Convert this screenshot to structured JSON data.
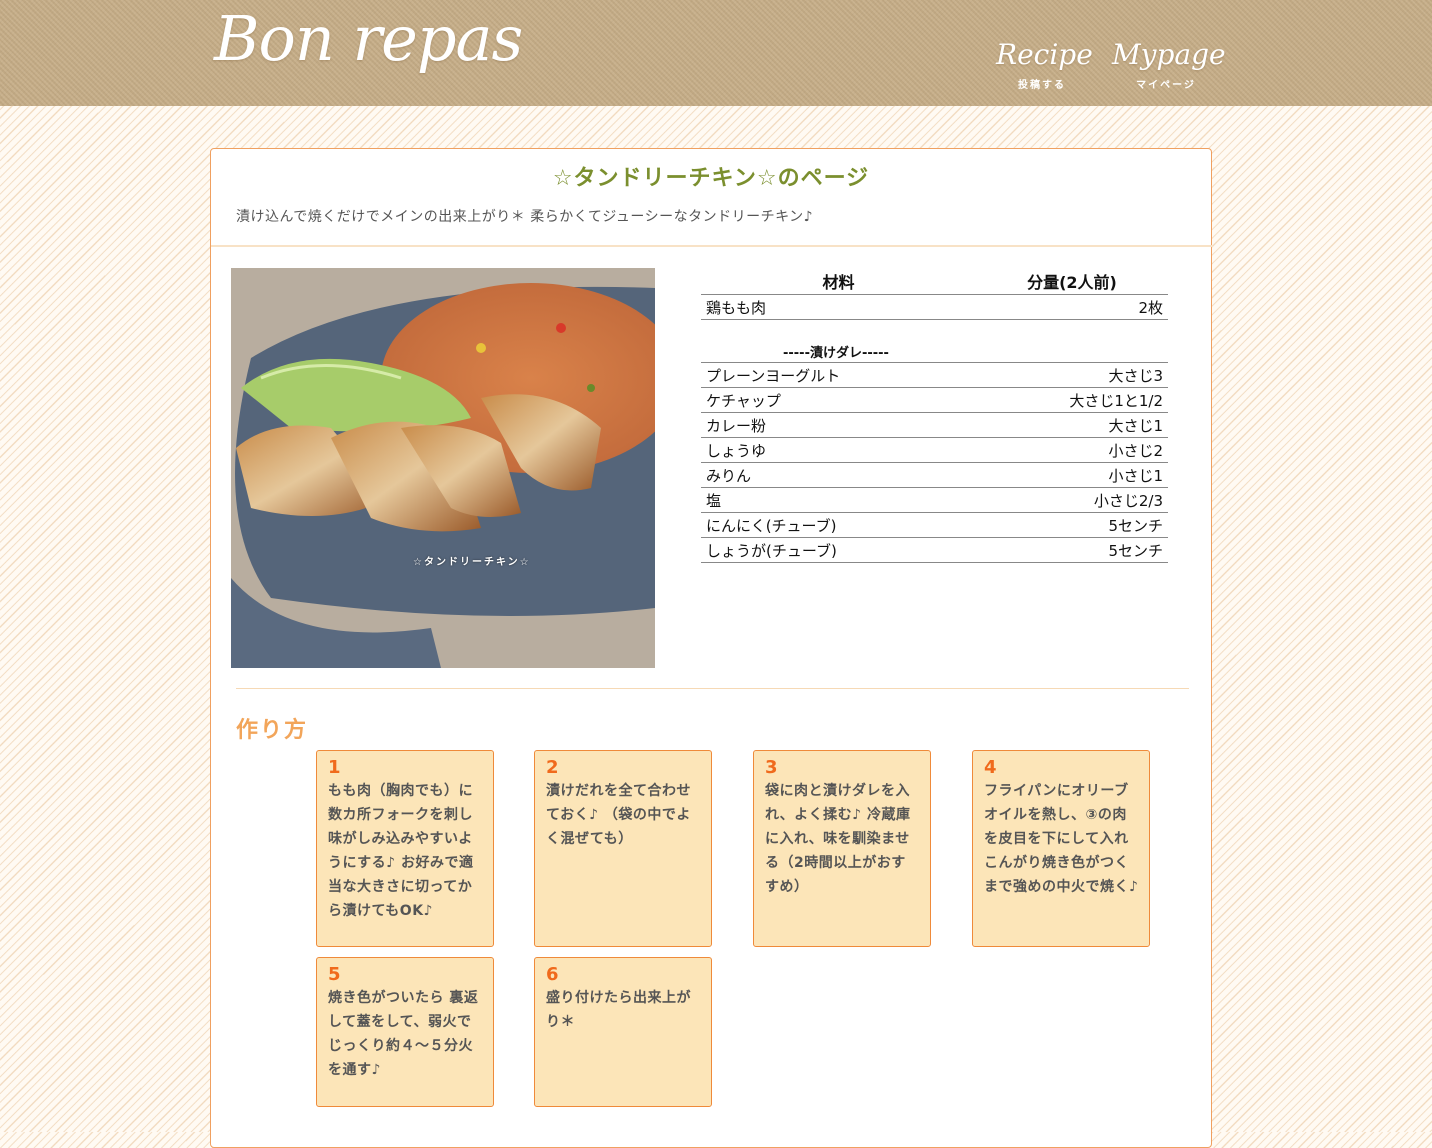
{
  "header": {
    "logo": "Bon repas",
    "nav": [
      {
        "en": "Recipe",
        "jp": "投稿する"
      },
      {
        "en": "Mypage",
        "jp": "マイページ"
      }
    ]
  },
  "recipe": {
    "title": "☆タンドリーチキン☆のページ",
    "description": "漬け込んで焼くだけでメインの出来上がり＊ 柔らかくてジューシーなタンドリーチキン♪",
    "photo_caption": "☆タンドリーチキン☆"
  },
  "ingredients": {
    "header_name": "材料",
    "header_amount": "分量(2人前)",
    "main": [
      {
        "name": "鶏もも肉",
        "amount": "2枚"
      }
    ],
    "section_label": "-----漬けダレ-----",
    "sauce": [
      {
        "name": "プレーンヨーグルト",
        "amount": "大さじ3"
      },
      {
        "name": "ケチャップ",
        "amount": "大さじ1と1/2"
      },
      {
        "name": "カレー粉",
        "amount": "大さじ1"
      },
      {
        "name": "しょうゆ",
        "amount": "小さじ2"
      },
      {
        "name": "みりん",
        "amount": "小さじ1"
      },
      {
        "name": "塩",
        "amount": "小さじ2/3"
      },
      {
        "name": "にんにく(チューブ)",
        "amount": "5センチ"
      },
      {
        "name": "しょうが(チューブ)",
        "amount": "5センチ"
      }
    ]
  },
  "instructions": {
    "title": "作り方",
    "steps": [
      {
        "num": "1",
        "text": "もも肉（胸肉でも）に数カ所フォークを刺し味がしみ込みやすいようにする♪ お好みで適当な大きさに切ってから漬けてもOK♪"
      },
      {
        "num": "2",
        "text": "漬けだれを全て合わせておく♪ （袋の中でよく混ぜても）"
      },
      {
        "num": "3",
        "text": "袋に肉と漬けダレを入れ、よく揉む♪ 冷蔵庫に入れ、味を馴染ませる（2時間以上がおすすめ）"
      },
      {
        "num": "4",
        "text": "フライパンにオリーブオイルを熱し、③の肉を皮目を下にして入れこんがり焼き色がつくまで強めの中火で焼く♪"
      },
      {
        "num": "5",
        "text": "焼き色がついたら 裏返して蓋をして、弱火でじっくり約４～５分火を通す♪"
      },
      {
        "num": "6",
        "text": "盛り付けたら出来上がり＊"
      }
    ]
  }
}
